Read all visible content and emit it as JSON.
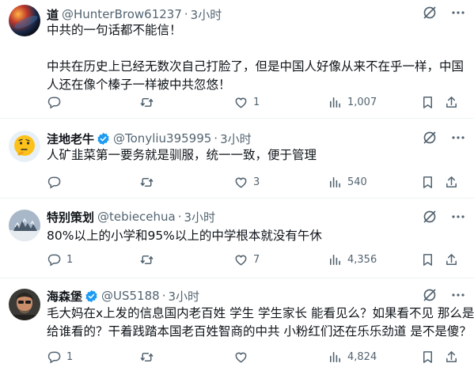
{
  "tweets": [
    {
      "name": "道",
      "handle": "@HunterBrow61237",
      "dot": "·",
      "time": "3小时",
      "verified": false,
      "avatar": "galaxy-avatar",
      "lines": [
        "中共的一句话都不能信！",
        "",
        "中共在历史上已经无数次自己打脸了，但是中国人好像从来不在乎一样，中国",
        "人还在像个榛子一样被中共忽悠！"
      ],
      "replies": "",
      "retweets": "",
      "likes": "1",
      "views": "1,007"
    },
    {
      "name": "洼地老牛",
      "handle": "@Tonyliu395995",
      "dot": "·",
      "time": "3小时",
      "verified": true,
      "avatar": "thinking-face-avatar",
      "lines": [
        "人矿韭菜第一要务就是驯服，统一一致，便于管理"
      ],
      "replies": "",
      "retweets": "",
      "likes": "3",
      "views": "540"
    },
    {
      "name": "特别策划",
      "handle": "@tebiecehua",
      "dot": "·",
      "time": "3小时",
      "verified": false,
      "avatar": "snow-tree-avatar",
      "lines": [
        "80%以上的小学和95%以上的中学根本就没有午休"
      ],
      "replies": "1",
      "retweets": "",
      "likes": "7",
      "views": "4,356"
    },
    {
      "name": "海森堡",
      "handle": "@US5188",
      "dot": "·",
      "time": "3小时",
      "verified": true,
      "avatar": "man-avatar",
      "lines": [
        "毛大妈在x上发的信息国内老百姓 学生 学生家长 能看见么？如果看不见 那么是",
        "给谁看的？干着践踏本国老百姓智商的中共 小粉红们还在乐乐劲道 是不是傻？"
      ],
      "replies": "1",
      "retweets": "",
      "likes": "",
      "views": "4,824"
    }
  ],
  "colors": {
    "text": "#0f1419",
    "muted": "#536471",
    "verified": "#1d9bf0",
    "divider": "#eff3f4"
  }
}
